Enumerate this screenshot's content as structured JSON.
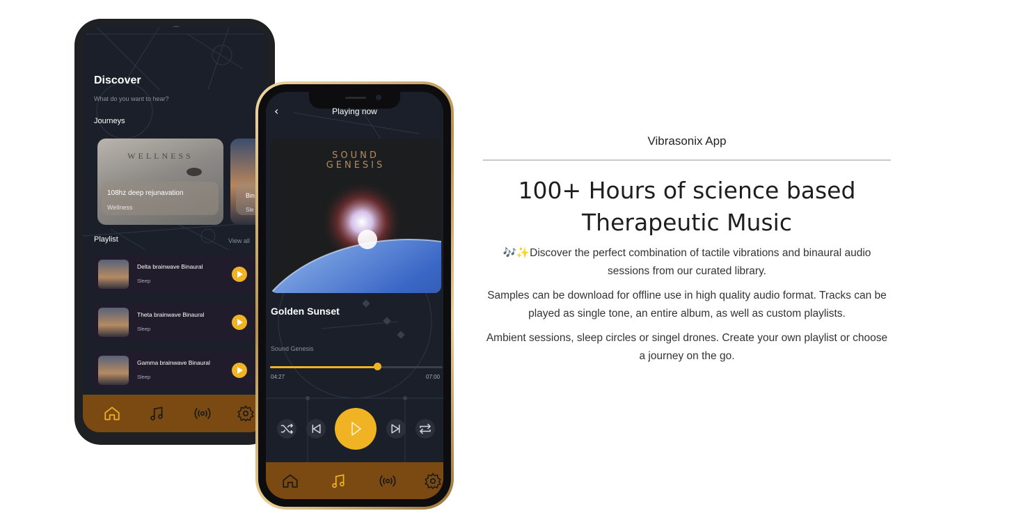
{
  "discover": {
    "title": "Discover",
    "subtitle": "What do you want to hear?",
    "journeys_label": "Journeys",
    "cards": [
      {
        "brand": "WELLNESS",
        "title": "108hz deep rejunavation",
        "subtitle": "Wellness"
      },
      {
        "title": "Bin",
        "subtitle": "Sle"
      }
    ],
    "playlist_label": "Playlist",
    "view_all": "View all",
    "playlist": [
      {
        "title": "Delta brainwave Binaural",
        "subtitle": "Sleep"
      },
      {
        "title": "Theta brainwave Binaural",
        "subtitle": "Sleep"
      },
      {
        "title": "Gamma brainwave Binaural",
        "subtitle": "Sleep"
      }
    ],
    "nav": [
      "home-icon",
      "music-note-icon",
      "broadcast-icon",
      "gear-icon"
    ],
    "active_nav": "home-icon"
  },
  "player": {
    "title": "Playing now",
    "back_glyph": "‹",
    "art_brand_line1": "SOUND",
    "art_brand_line2": "GENESIS",
    "track_title": "Golden Sunset",
    "artist": "Sound Genesis",
    "current_time": "04:27",
    "total_time": "07:00",
    "progress": 0.62,
    "controls": [
      "shuffle-icon",
      "previous-icon",
      "play-icon",
      "next-icon",
      "repeat-icon"
    ],
    "nav": [
      "home-icon",
      "music-note-icon",
      "broadcast-icon",
      "gear-icon"
    ],
    "active_nav": "music-note-icon"
  },
  "info": {
    "app_label": "Vibrasonix App",
    "headline": "100+ Hours of science based Therapeutic Music",
    "paragraphs": [
      "🎶✨Discover the perfect combination of tactile vibrations and binaural audio sessions from our curated library.",
      "Samples can be download for offline use in high quality audio format. Tracks can be played as single tone, an entire album, as well as custom playlists.",
      "Ambient sessions, sleep circles or singel drones. Create your own playlist or choose a journey on the go."
    ]
  },
  "colors": {
    "accent": "#f0b323",
    "nav_bar": "#7a4a12",
    "screen_bg": "#1a1f29"
  }
}
